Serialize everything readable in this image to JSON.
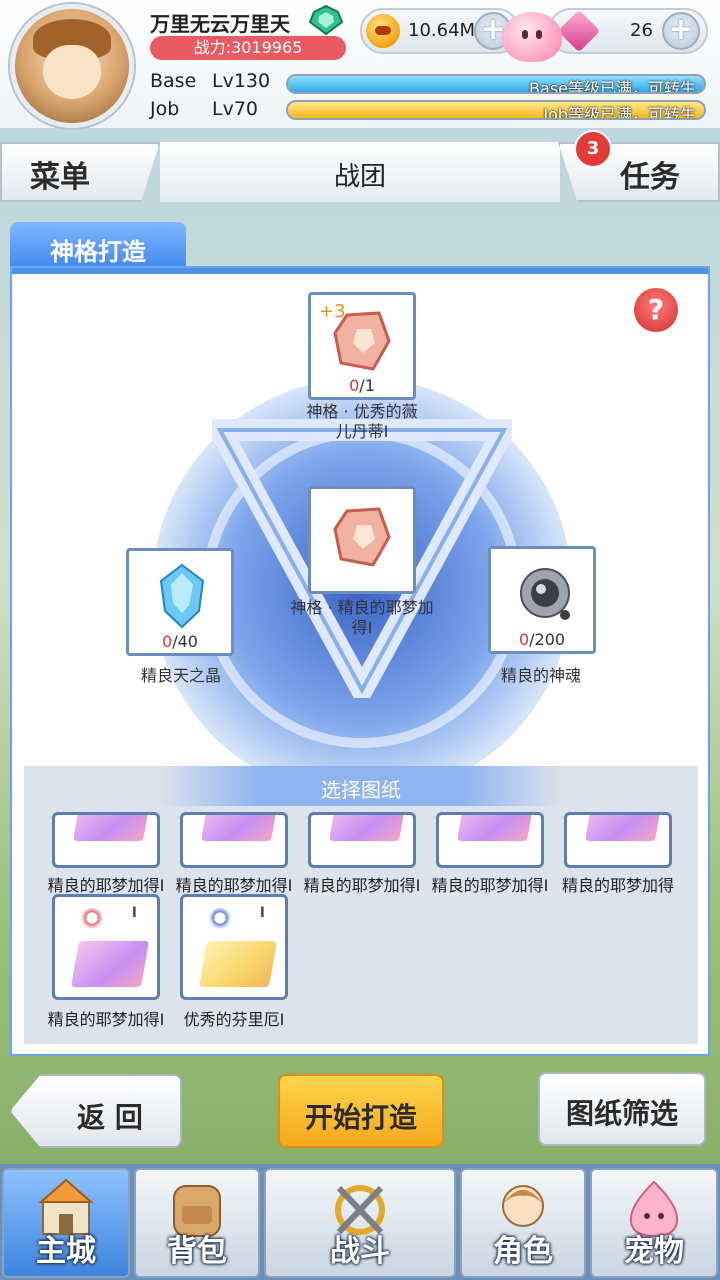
{
  "player": {
    "name": "万里无云万里天",
    "power": "战力:3019965",
    "base_label": "Base",
    "base_level": "Lv130",
    "base_status": "Base等级已满，可转生",
    "base_progress": 1.0,
    "job_label": "Job",
    "job_level": "Lv70",
    "job_status": "Job等级已满，可转生",
    "job_progress": 1.0
  },
  "currency": {
    "gold": "10.64M",
    "gems": "26"
  },
  "nav": {
    "menu": "菜单",
    "title": "战团",
    "tasks": "任务",
    "task_badge": "3"
  },
  "panel": {
    "tab_label": "神格打造",
    "help": "?",
    "top_slot": {
      "bonus": "+3",
      "have": "0",
      "need": "/1",
      "name_line1": "神格 · 优秀的薇",
      "name_line2": "儿丹蒂Ⅰ"
    },
    "center_slot": {
      "name_line1": "神格 · 精良的耶梦加",
      "name_line2": "得Ⅰ"
    },
    "left_slot": {
      "have": "0",
      "need": "/40",
      "name": "精良天之晶"
    },
    "right_slot": {
      "have": "0",
      "need": "/200",
      "name": "精良的神魂"
    }
  },
  "blueprints": {
    "title": "选择图纸",
    "row1": [
      {
        "label": "精良的耶梦加得Ⅰ"
      },
      {
        "label": "精良的耶梦加得Ⅰ"
      },
      {
        "label": "精良的耶梦加得Ⅰ"
      },
      {
        "label": "精良的耶梦加得Ⅰ"
      },
      {
        "label": "精良的耶梦加得"
      }
    ],
    "row2": [
      {
        "label": "精良的耶梦加得Ⅰ",
        "tier": "I",
        "color": "pink"
      },
      {
        "label": "优秀的芬里厄Ⅰ",
        "tier": "I",
        "color": "gold"
      }
    ]
  },
  "actions": {
    "back": "返 回",
    "start": "开始打造",
    "filter": "图纸筛选"
  },
  "bottom_nav": [
    {
      "label": "主城",
      "icon": "castle-icon"
    },
    {
      "label": "背包",
      "icon": "backpack-icon"
    },
    {
      "label": "战斗",
      "icon": "battle-icon"
    },
    {
      "label": "角色",
      "icon": "character-icon"
    },
    {
      "label": "宠物",
      "icon": "pet-icon"
    }
  ]
}
